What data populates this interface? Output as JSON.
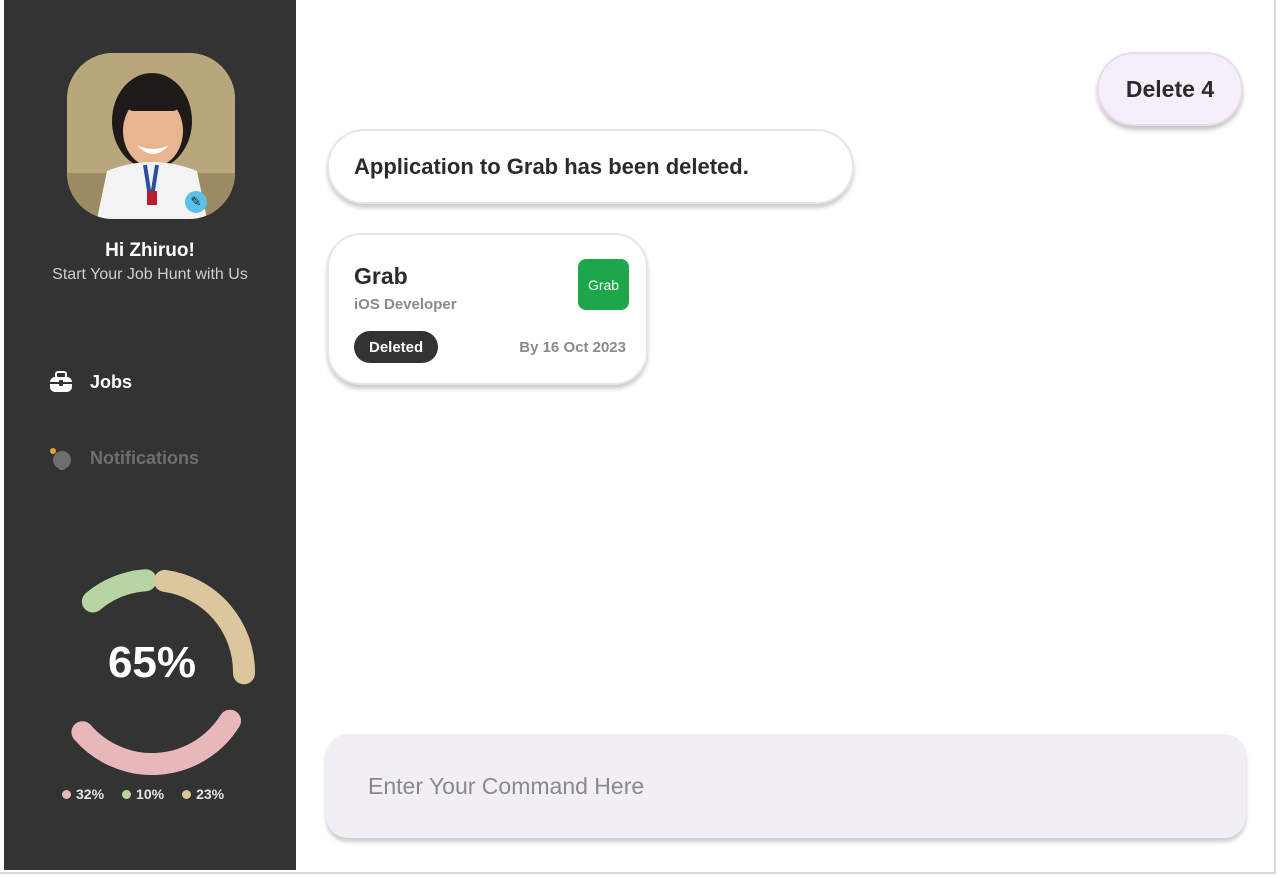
{
  "sidebar": {
    "greeting": "Hi Zhiruo!",
    "subtitle": "Start Your Job Hunt with Us",
    "nav": {
      "jobs_label": "Jobs",
      "notifications_label": "Notifications"
    },
    "progress": {
      "value_label": "65%",
      "segments": [
        {
          "label": "32%",
          "value": 32,
          "color": "#e8b7b9"
        },
        {
          "label": "10%",
          "value": 10,
          "color": "#b7d5a3"
        },
        {
          "label": "23%",
          "value": 23,
          "color": "#dcc69e"
        }
      ]
    }
  },
  "header": {
    "delete_button_label": "Delete 4"
  },
  "messages": [
    {
      "text": "Application to Grab has been deleted."
    }
  ],
  "job_card": {
    "company": "Grab",
    "role": "iOS Developer",
    "logo_text": "Grab",
    "logo_color": "#1ea64a",
    "status": "Deleted",
    "due": "By 16 Oct 2023"
  },
  "command": {
    "placeholder": "Enter Your Command Here",
    "value": ""
  },
  "icons": {
    "jobs": "briefcase-icon",
    "notifications": "bell-icon"
  },
  "colors": {
    "sidebar_bg": "#333333",
    "accent_delete": "#f7eefb",
    "command_bg": "#f1eff5"
  }
}
